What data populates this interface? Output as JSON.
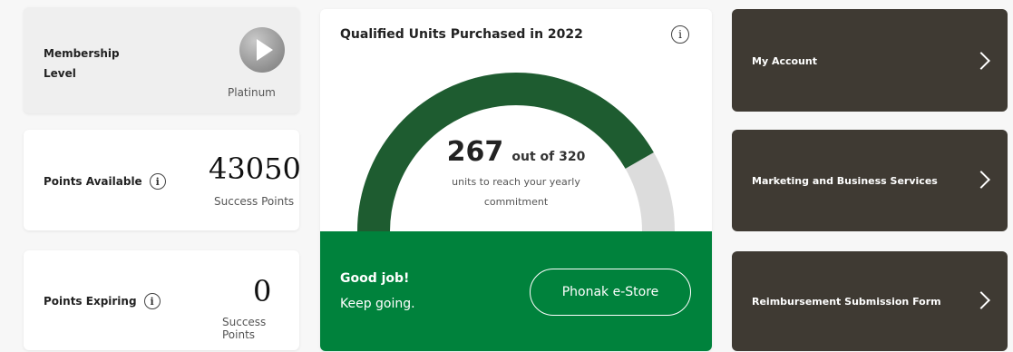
{
  "membership": {
    "label": "Membership Level",
    "tier": "Platinum",
    "icon": "play-badge-icon"
  },
  "points_available": {
    "label": "Points Available",
    "value": "43050",
    "unit": "Success Points"
  },
  "points_expiring": {
    "label": "Points Expiring",
    "value": "0",
    "unit": "Success Points"
  },
  "qualified": {
    "title": "Qualified Units Purchased in 2022",
    "count": "267",
    "out_of": "out of 320",
    "caption": "units to reach your yearly commitment",
    "purchased": 267,
    "target": 320,
    "colors": {
      "progress": "#1e5c30",
      "track": "#dcdcdc",
      "panel": "#00823c"
    }
  },
  "encouragement": {
    "line1": "Good job!",
    "line2": "Keep going."
  },
  "estore_button": "Phonak e-Store",
  "info_glyph": "i",
  "nav": [
    {
      "label": "My Account"
    },
    {
      "label": "Marketing and Business Services"
    },
    {
      "label": "Reimbursement Submission Form"
    }
  ]
}
